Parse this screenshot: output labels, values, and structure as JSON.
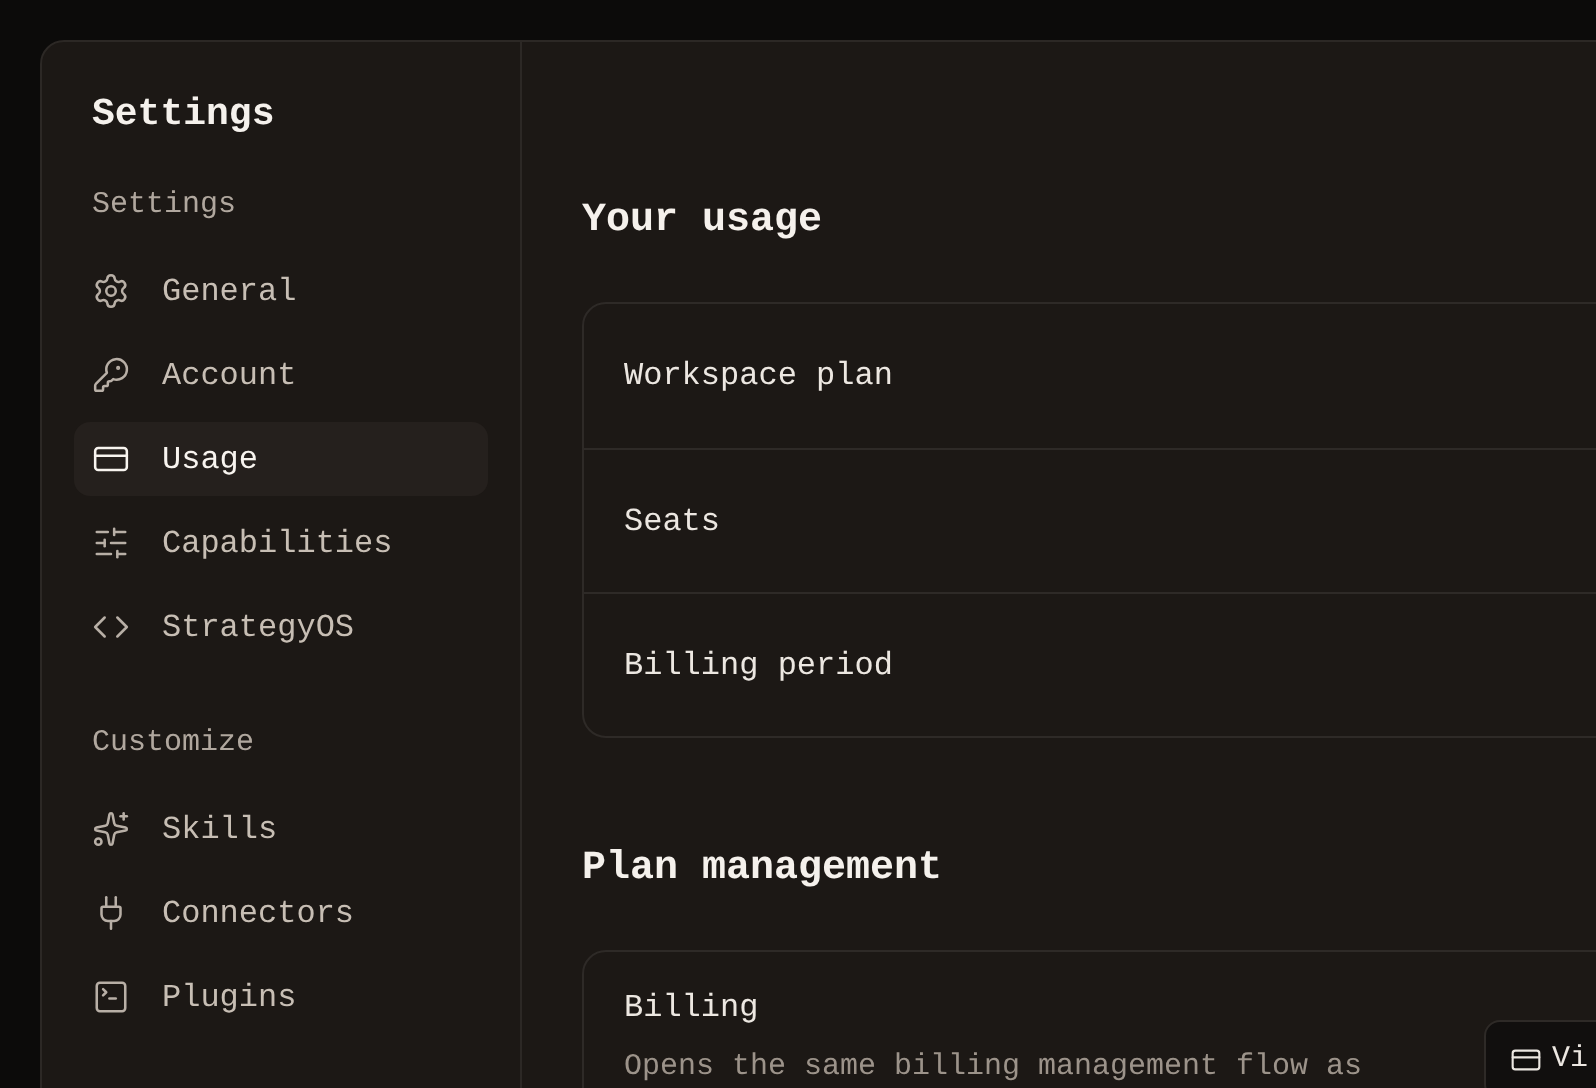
{
  "dialog": {
    "title": "Settings"
  },
  "sidebar": {
    "sections": [
      {
        "label": "Settings",
        "items": [
          {
            "label": "General",
            "selected": false
          },
          {
            "label": "Account",
            "selected": false
          },
          {
            "label": "Usage",
            "selected": true
          },
          {
            "label": "Capabilities",
            "selected": false
          },
          {
            "label": "StrategyOS",
            "selected": false
          }
        ]
      },
      {
        "label": "Customize",
        "items": [
          {
            "label": "Skills",
            "selected": false
          },
          {
            "label": "Connectors",
            "selected": false
          },
          {
            "label": "Plugins",
            "selected": false
          }
        ]
      }
    ]
  },
  "usage": {
    "title": "Your usage",
    "rows": [
      "Workspace plan",
      "Seats",
      "Billing period"
    ]
  },
  "plan_management": {
    "title": "Plan management",
    "billing": {
      "title": "Billing",
      "description": "Opens the same billing management flow as",
      "button": "Vi"
    }
  }
}
